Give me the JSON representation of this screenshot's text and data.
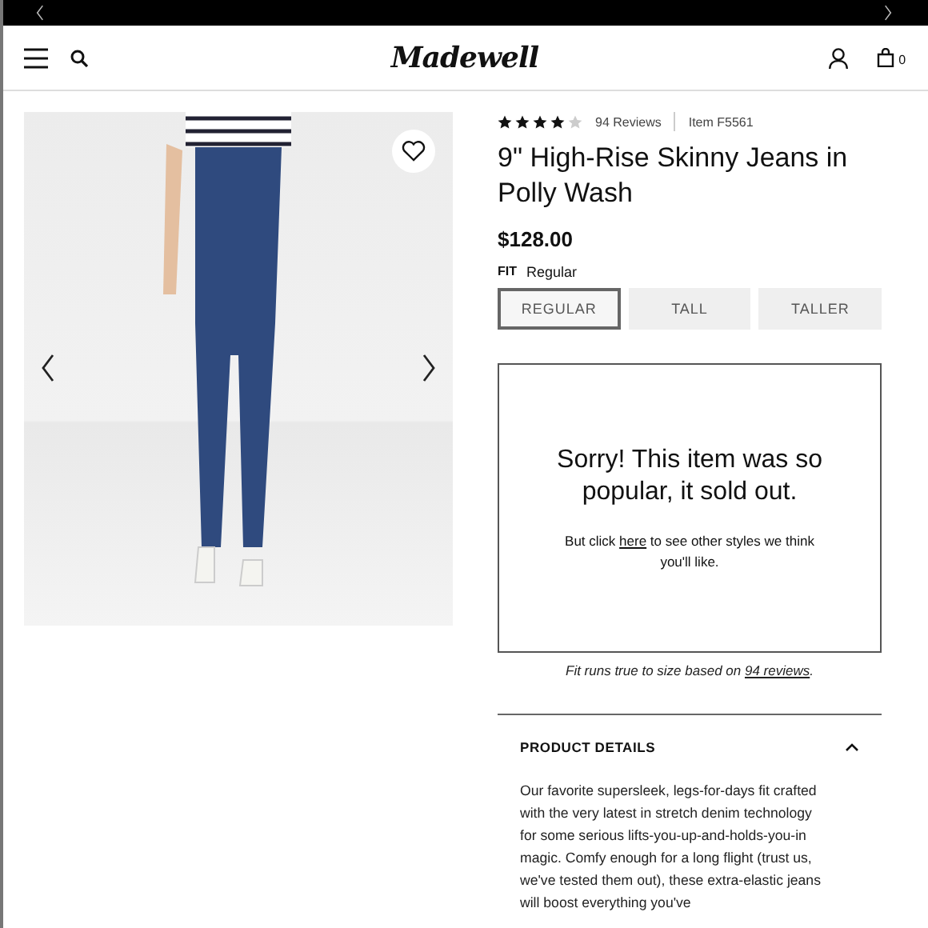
{
  "header": {
    "logo": "Madewell",
    "cart_count": "0"
  },
  "gallery": {
    "favorited": false
  },
  "product": {
    "stars": 4,
    "reviews": "94 Reviews",
    "item": "Item F5561",
    "title": "9\" High-Rise Skinny Jeans in Polly Wash",
    "price": "$128.00",
    "fit_label": "FIT",
    "fit_value": "Regular",
    "fit_options": [
      {
        "label": "REGULAR",
        "selected": true
      },
      {
        "label": "TALL",
        "selected": false
      },
      {
        "label": "TALLER",
        "selected": false
      }
    ],
    "sold_out": {
      "heading": "Sorry! This item was so popular, it sold out.",
      "before": "But click",
      "link": "here",
      "after": "to see other styles we think you'll like."
    },
    "fit_note": {
      "text": "Fit runs true to size based on",
      "link": "94 reviews",
      "end": "."
    },
    "details": {
      "title": "PRODUCT DETAILS",
      "expanded": true,
      "text": "Our favorite supersleek, legs-for-days fit crafted with the very latest in stretch denim technology for some serious lifts-you-up-and-holds-you-in magic. Comfy enough for a long flight (trust us, we've tested them out), these extra-elastic jeans will boost everything you've"
    }
  }
}
